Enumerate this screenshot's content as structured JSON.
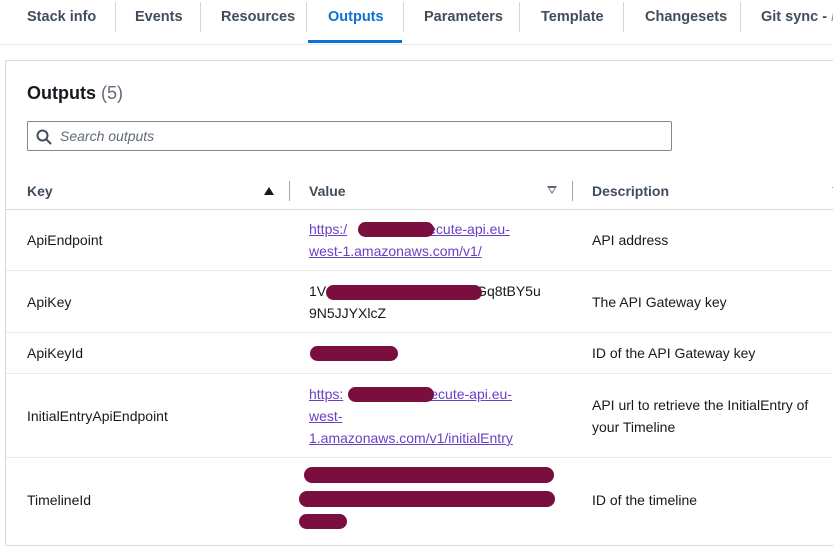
{
  "tabs": [
    {
      "label": "Stack info"
    },
    {
      "label": "Events"
    },
    {
      "label": "Resources"
    },
    {
      "label": "Outputs",
      "active": true
    },
    {
      "label": "Parameters"
    },
    {
      "label": "Template"
    },
    {
      "label": "Changesets"
    },
    {
      "label": "Git sync -",
      "suffix": "n"
    }
  ],
  "outputs": {
    "title": "Outputs",
    "count": "(5)",
    "search_placeholder": "Search outputs",
    "columns": {
      "key": "Key",
      "value": "Value",
      "description": "Description"
    },
    "rows": [
      {
        "key": "ApiEndpoint",
        "value_lines": [
          "https:/",
          "xecute-api.eu-",
          "west-1.amazonaws.com/v1/"
        ],
        "description": "API address"
      },
      {
        "key": "ApiKey",
        "value_lines": [
          "1V",
          "Gq8tBY5u",
          "9N5JJYXlcZ"
        ],
        "description": "The API Gateway key"
      },
      {
        "key": "ApiKeyId",
        "value_lines": [],
        "description": "ID of the API Gateway key"
      },
      {
        "key": "InitialEntryApiEndpoint",
        "value_lines": [
          "https:",
          "xecute-api.eu-",
          "west-",
          "1.amazonaws.com/v1/initialEntry"
        ],
        "description": "API url to retrieve the InitialEntry of your Timeline"
      },
      {
        "key": "TimelineId",
        "value_lines": [],
        "description": "ID of the timeline"
      }
    ]
  },
  "colors": {
    "accent": "#0972d3",
    "visited_link": "#6b40c4",
    "redaction": "#7a0e3f"
  }
}
